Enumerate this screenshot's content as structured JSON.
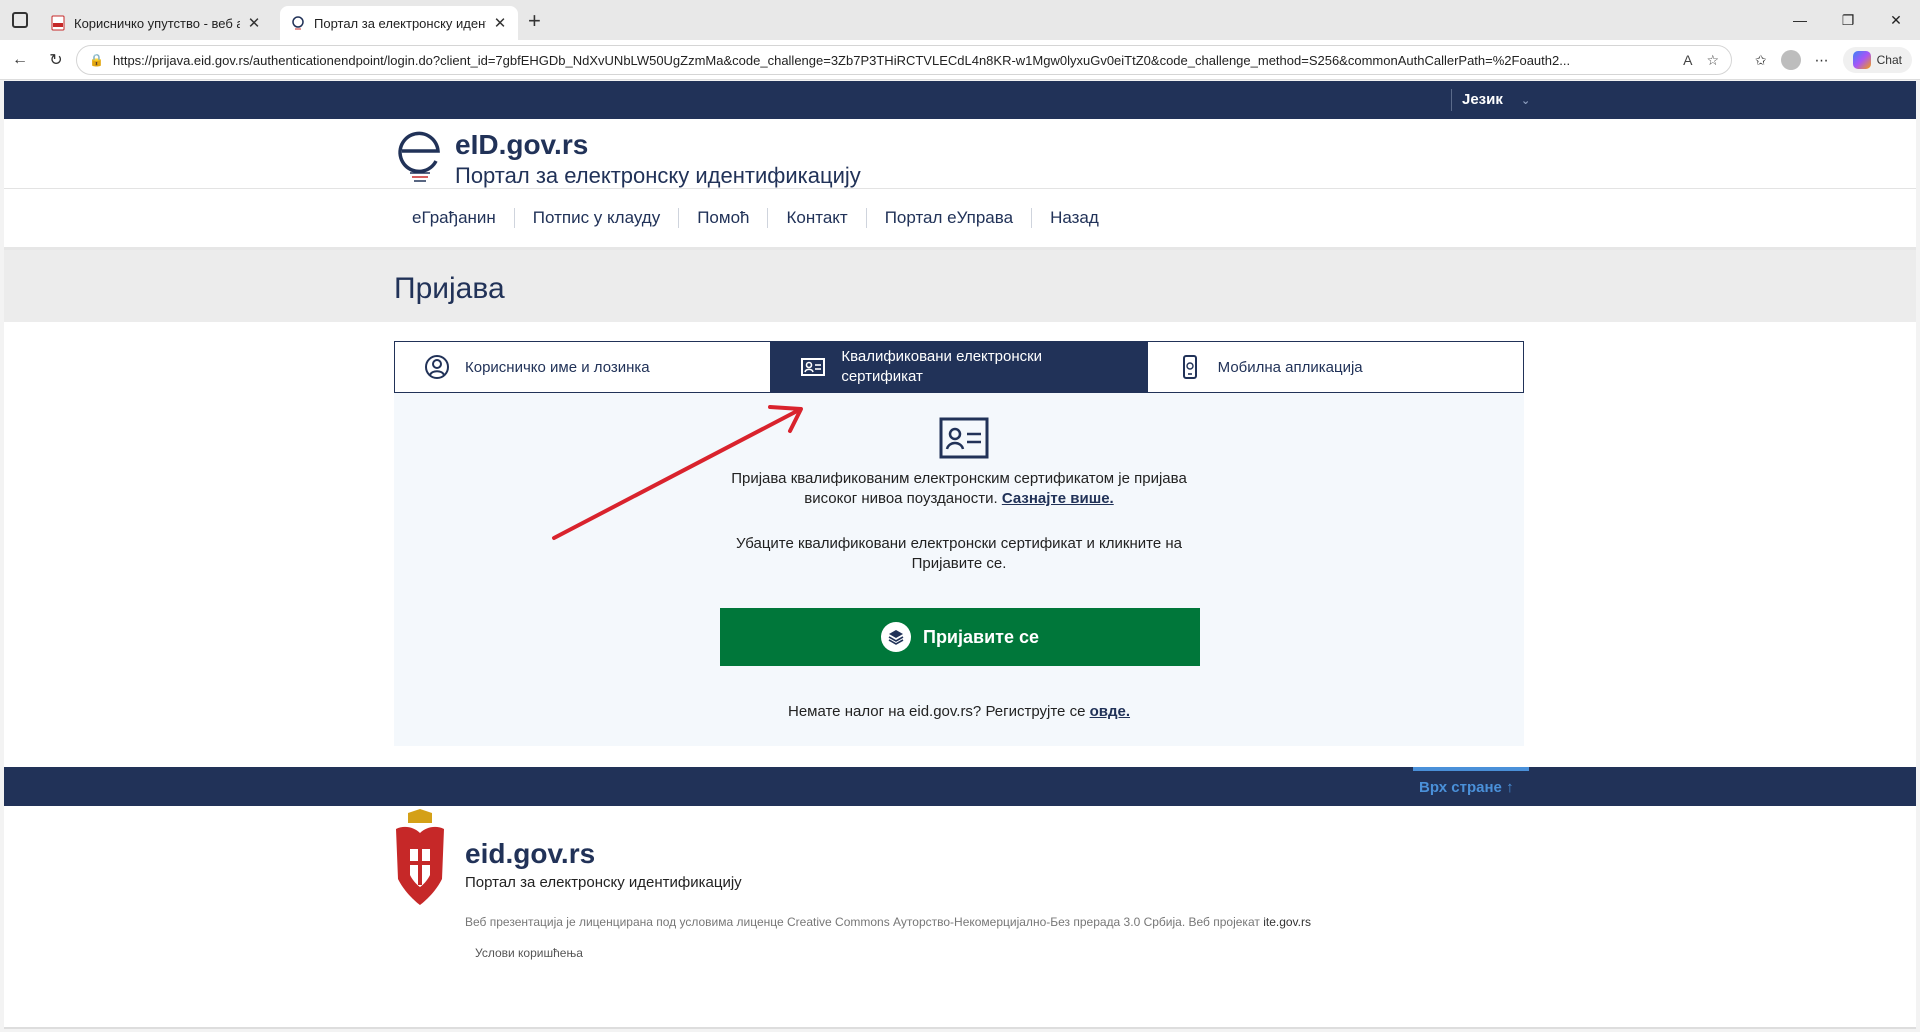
{
  "browser": {
    "tabs": [
      {
        "title": "Корисничко упутство - веб апликација",
        "icon": "pdf-icon"
      },
      {
        "title": "Портал за електронску идентификацију",
        "icon": "eid-favicon"
      }
    ],
    "url": "https://prijava.eid.gov.rs/authenticationendpoint/login.do?client_id=7gbfEHGDb_NdXvUNbLW50UgZzmMa&code_challenge=3Zb7P3THiRCTVLECdL4n8KR-w1Mgw0lyxuGv0eiTtZ0&code_challenge_method=S256&commonAuthCallerPath=%2Foauth2...",
    "chat_label": "Chat"
  },
  "site": {
    "language": "Језик",
    "brand": "eID.gov.rs",
    "brand_sub": "Портал за електронску идентификацију",
    "menu": [
      "еГрађанин",
      "Потпис у клауду",
      "Помоћ",
      "Контакт",
      "Портал еУправа",
      "Назад"
    ],
    "page_title": "Пријава"
  },
  "login": {
    "tabs": [
      {
        "label": "Корисничко име и лозинка",
        "icon": "user-circle-icon",
        "active": false
      },
      {
        "label": "Квалификовани електронски сертификат",
        "icon": "id-card-icon",
        "active": true
      },
      {
        "label": "Мобилна апликација",
        "icon": "mobile-phone-icon",
        "active": false
      }
    ],
    "info_line1": "Пријава квалификованим електронским сертификатом је пријава",
    "info_line2": "високог нивоа поузданости.",
    "learn_more": "Сазнајте више.",
    "instruct_line1": "Убаците квалификовани електронски сертификат и кликните на",
    "instruct_line2": "Пријавите се.",
    "button": "Пријавите се",
    "register_text": "Немате налог на eid.gov.rs? Региструјте се",
    "register_link": "овде."
  },
  "footer": {
    "back_to_top": "Врх стране",
    "brand": "eid.gov.rs",
    "brand_sub": "Портал за електронску идентификацију",
    "license": "Веб презентација је лиценцирана под условима лиценце Creative Commons Ауторство-Некомерцијално-Без прерада 3.0 Србија. Веб пројекат",
    "license_link": "ite.gov.rs",
    "terms": "Услови коришћења"
  },
  "colors": {
    "navy": "#213258",
    "green": "#00773a",
    "annotation": "#d9232d"
  }
}
